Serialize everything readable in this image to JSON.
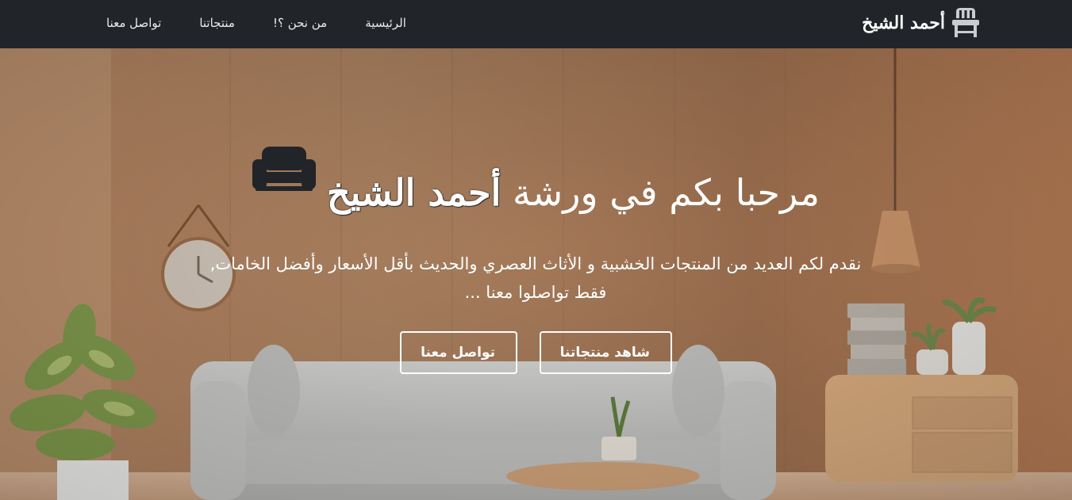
{
  "navbar": {
    "brand_text": "أحمد الشيخ",
    "brand_icon": "chair-icon",
    "links": [
      {
        "label": "الرئيسية"
      },
      {
        "label": "من نحن ؟!"
      },
      {
        "label": "منتجاتنا"
      },
      {
        "label": "تواصل معنا"
      }
    ],
    "background": "#212529"
  },
  "hero": {
    "title_prefix": "مرحبا بكم في ورشة",
    "title_brand": "أحمد الشيخ",
    "title_icon": "sofa-icon",
    "description": "نقدم لكم العديد من المنتجات الخشبية و الأثاث العصري والحديث بأقل الأسعار وأفضل الخامات, فقط تواصلوا معنا ...",
    "buttons": {
      "products": "شاهد منتجاتنا",
      "contact": "تواصل معنا"
    },
    "background_image": "living-room-photo"
  }
}
